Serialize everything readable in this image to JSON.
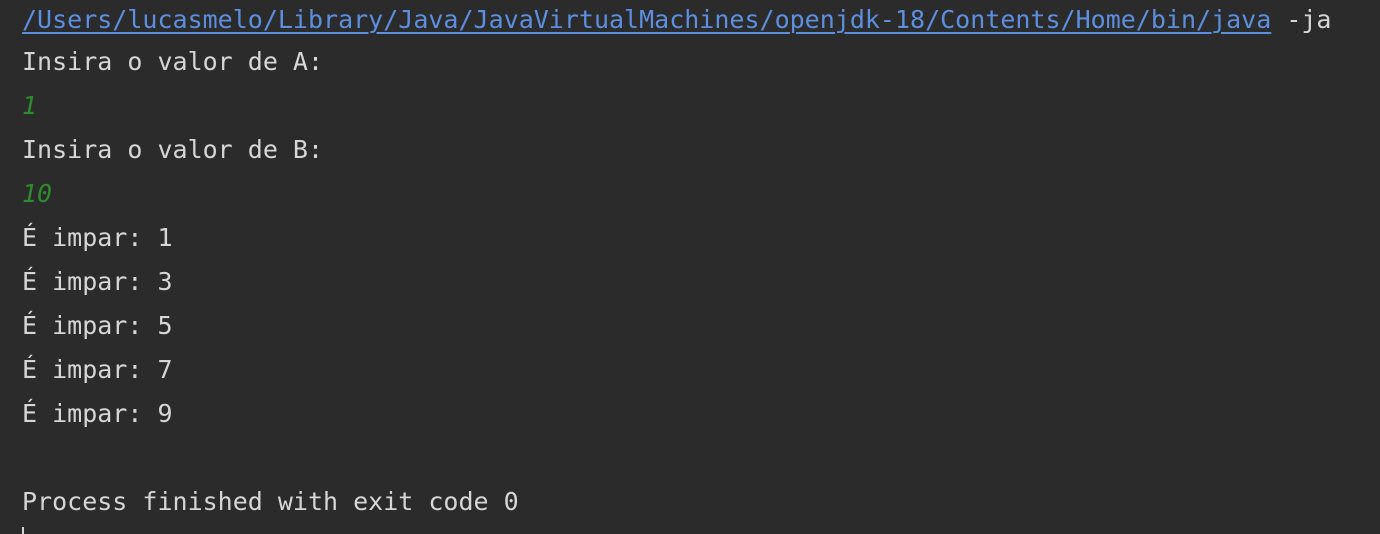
{
  "console": {
    "command_path": "/Users/lucasmelo/Library/Java/JavaVirtualMachines/openjdk-18/Contents/Home/bin/java",
    "command_rest": " -ja",
    "lines": [
      {
        "text": "Insira o valor de A:",
        "kind": "output"
      },
      {
        "text": "1",
        "kind": "input"
      },
      {
        "text": "Insira o valor de B:",
        "kind": "output"
      },
      {
        "text": "10",
        "kind": "input"
      },
      {
        "text": "É impar: 1",
        "kind": "output"
      },
      {
        "text": "É impar: 3",
        "kind": "output"
      },
      {
        "text": "É impar: 5",
        "kind": "output"
      },
      {
        "text": "É impar: 7",
        "kind": "output"
      },
      {
        "text": "É impar: 9",
        "kind": "output"
      },
      {
        "text": "",
        "kind": "output"
      },
      {
        "text": "Process finished with exit code 0",
        "kind": "output"
      }
    ]
  },
  "colors": {
    "background": "#2b2b2b",
    "text": "#d6d6d6",
    "link": "#5c8fe0",
    "user_input": "#2e8b2e"
  }
}
